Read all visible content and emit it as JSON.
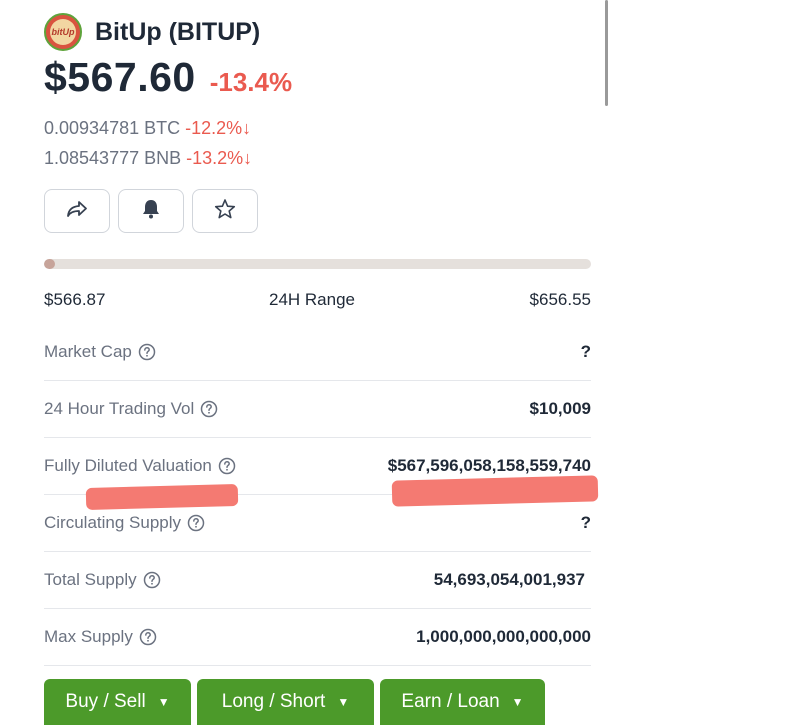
{
  "coin": {
    "logo_text": "bitUp",
    "name": "BitUp (BITUP)",
    "price": "$567.60",
    "change_24h": "-13.4%",
    "conversions": [
      {
        "value": "0.00934781 BTC",
        "change": "-12.2%",
        "arrow": "↓"
      },
      {
        "value": "1.08543777 BNB",
        "change": "-13.2%",
        "arrow": "↓"
      }
    ]
  },
  "icons": {
    "share": "share-icon",
    "alert": "bell-icon",
    "watchlist": "star-icon",
    "help": "question-circle-icon"
  },
  "range": {
    "low": "$566.87",
    "label": "24H Range",
    "high": "$656.55",
    "current_position_fraction": 0.008
  },
  "stats": [
    {
      "label": "Market Cap",
      "value": "?"
    },
    {
      "label": "24 Hour Trading Vol",
      "value": "$10,009"
    },
    {
      "label": "Fully Diluted Valuation",
      "value": "$567,596,058,158,559,740"
    },
    {
      "label": "Circulating Supply",
      "value": "?"
    },
    {
      "label": "Total Supply",
      "value": "54,693,054,001,937"
    },
    {
      "label": "Max Supply",
      "value": "1,000,000,000,000,000"
    }
  ],
  "actions": [
    {
      "label": "Buy / Sell"
    },
    {
      "label": "Long / Short"
    },
    {
      "label": "Earn / Loan"
    }
  ],
  "colors": {
    "negative": "#ea5a4f",
    "action_green": "#4c9a2a",
    "redaction": "#f47a72"
  }
}
